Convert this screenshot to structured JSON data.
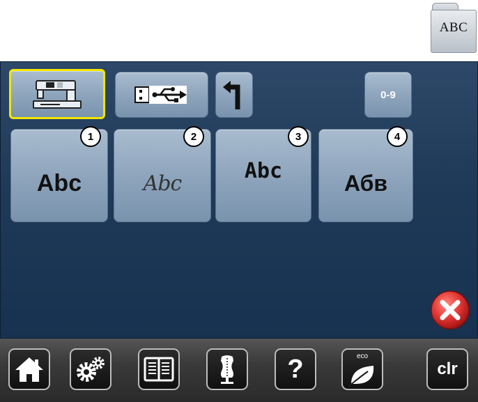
{
  "folder": {
    "label": "ABC",
    "icon": "folder-icon"
  },
  "top_row": {
    "machine_button": {
      "icon": "sewing-machine-icon",
      "selected": true
    },
    "usb_button": {
      "icon": "usb-icon"
    },
    "back_button": {
      "icon": "return-arrow-icon"
    },
    "digits_button": {
      "label": "0-9"
    }
  },
  "fonts": [
    {
      "badge": "1",
      "sample": "Abc"
    },
    {
      "badge": "2",
      "sample": "Abc"
    },
    {
      "badge": "3",
      "sample": "Abc"
    },
    {
      "badge": "4",
      "sample": "Абв"
    }
  ],
  "close_button": {
    "icon": "close-icon",
    "color": "#e53935"
  },
  "toolbar": {
    "items": [
      {
        "icon": "home-icon"
      },
      {
        "icon": "gears-icon"
      },
      {
        "icon": "book-icon"
      },
      {
        "icon": "mannequin-icon"
      },
      {
        "icon": "help-icon",
        "label": "?"
      },
      {
        "icon": "eco-leaf-icon",
        "label": "eco"
      },
      {
        "icon": "clear-icon",
        "label": "clr"
      }
    ]
  },
  "colors": {
    "screen": "#1f3958",
    "button": "#8ca3bb",
    "selected_border": "#f2e600"
  }
}
